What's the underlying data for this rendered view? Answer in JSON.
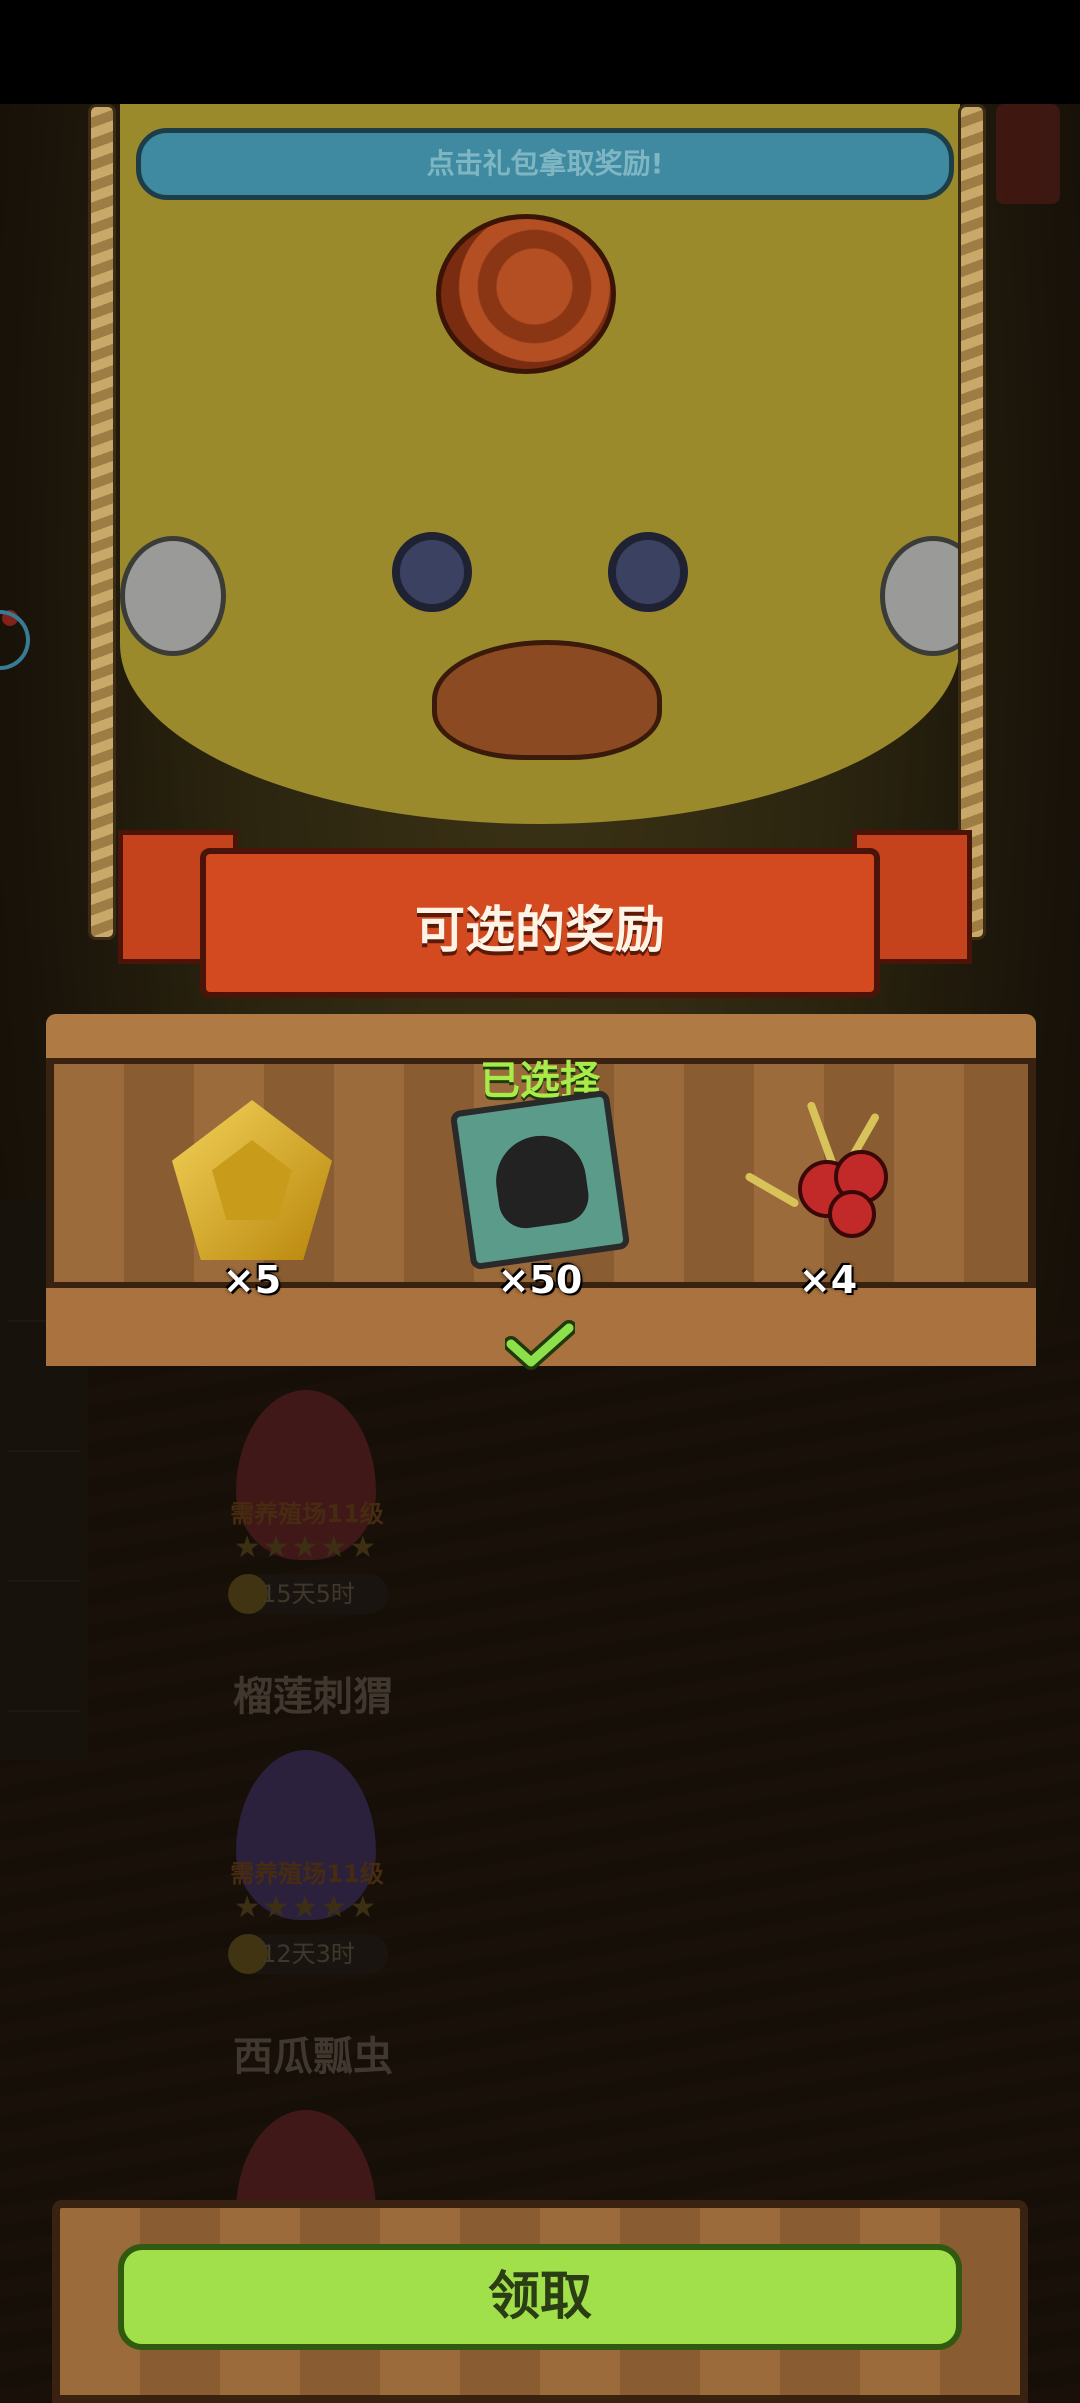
{
  "hint_banner": "点击礼包拿取奖励!",
  "panel_title": "可选的奖励",
  "selected_label": "已选择",
  "rewards": [
    {
      "icon": "gold-gem-icon",
      "qty": "×5"
    },
    {
      "icon": "card-pack-icon",
      "qty": "×50",
      "selected": true
    },
    {
      "icon": "coral-icon",
      "qty": "×4"
    }
  ],
  "claim_button": "领取",
  "background": {
    "eggs": [
      {
        "requirement": "需养殖场11级",
        "stars": "★★★★★",
        "timer": "15天5时",
        "progress": 0.25,
        "color": "#6e2a2a"
      },
      {
        "requirement": "需养殖场11级",
        "stars": "★★★★★",
        "timer": "12天3时",
        "progress": 0.25,
        "color": "#4a3a6a"
      }
    ],
    "creature_names": [
      "榴莲刺猬",
      "西瓜瓢虫"
    ]
  },
  "colors": {
    "accent_green": "#a2e04b",
    "ribbon_red": "#d34a20",
    "hint_blue": "#3f8aa0"
  }
}
